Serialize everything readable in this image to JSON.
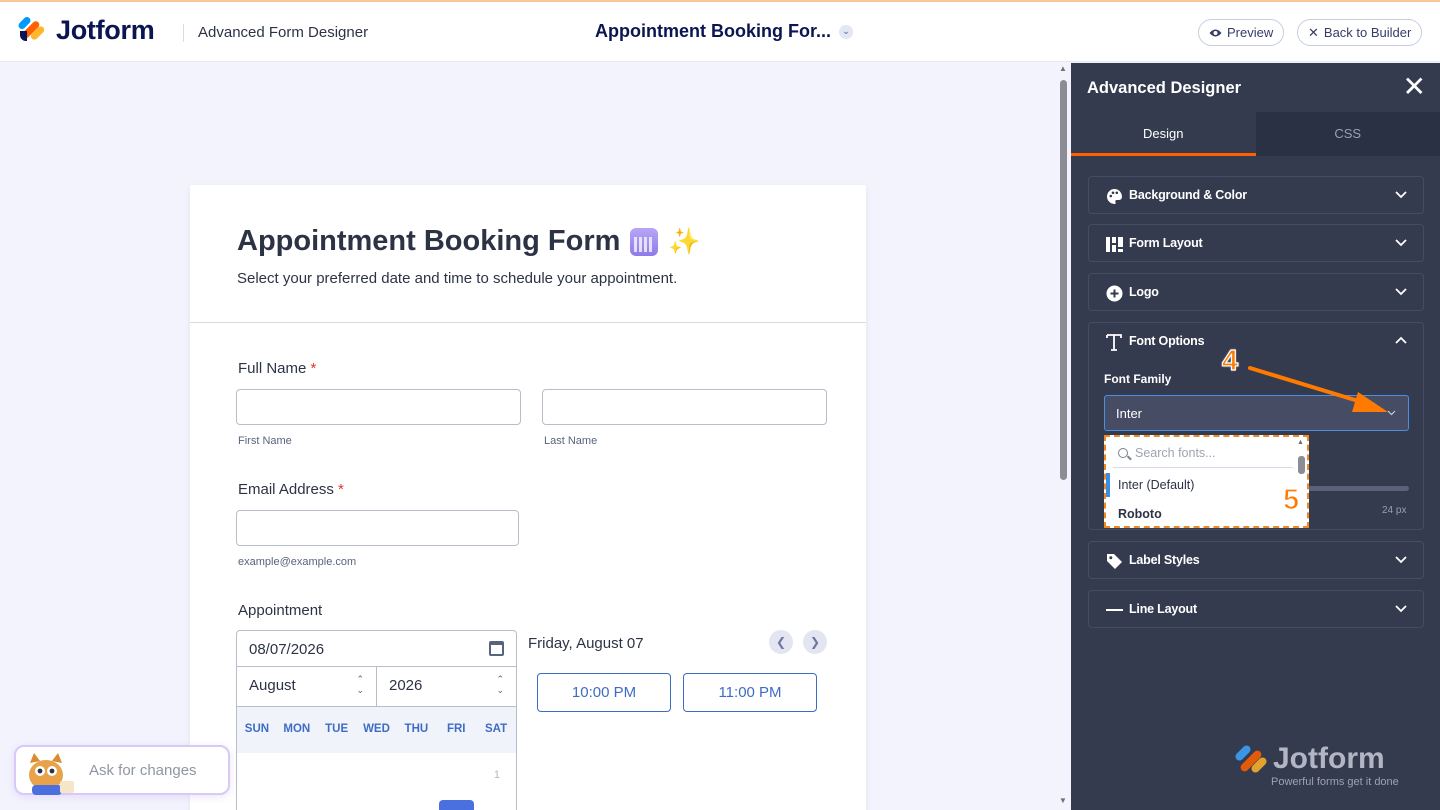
{
  "header": {
    "logo_text": "Jotform",
    "app_subtitle": "Advanced Form Designer",
    "form_title": "Appointment Booking For...",
    "preview_label": "Preview",
    "back_label": "Back to Builder"
  },
  "form": {
    "title": "Appointment Booking Form",
    "subtitle": "Select your preferred date and time to schedule your appointment.",
    "full_name": {
      "label": "Full Name",
      "required_mark": "*",
      "first_sub": "First Name",
      "last_sub": "Last Name"
    },
    "email": {
      "label": "Email Address",
      "required_mark": "*",
      "sub": "example@example.com"
    },
    "appointment": {
      "label": "Appointment",
      "date_value": "08/07/2026",
      "month": "August",
      "year": "2026",
      "weekdays": [
        "SUN",
        "MON",
        "TUE",
        "WED",
        "THU",
        "FRI",
        "SAT"
      ],
      "first_day": "1",
      "selected_date_heading": "Friday, August 07",
      "time_slots": [
        "10:00 PM",
        "11:00 PM"
      ]
    }
  },
  "ask": {
    "placeholder": "Ask for changes"
  },
  "panel": {
    "title": "Advanced Designer",
    "tabs": [
      "Design",
      "CSS"
    ],
    "active_tab": "Design",
    "sections": {
      "background": "Background & Color",
      "form_layout": "Form Layout",
      "logo": "Logo",
      "font_options": "Font Options",
      "label_styles": "Label Styles",
      "line_layout": "Line Layout"
    },
    "font_family_label": "Font Family",
    "font_family_value": "Inter",
    "font_size_value": "24 px",
    "dropdown": {
      "search_placeholder": "Search fonts...",
      "options": [
        "Inter (Default)",
        "Roboto"
      ]
    }
  },
  "annotations": {
    "step4": "4",
    "step5": "5",
    "accent_color": "#ff7a00"
  },
  "brand_footer": {
    "name": "Jotform",
    "tagline": "Powerful forms get it done"
  },
  "colors": {
    "accent_orange": "#ff6100",
    "panel_bg": "#353b4f",
    "primary_blue": "#3e6cc5"
  }
}
